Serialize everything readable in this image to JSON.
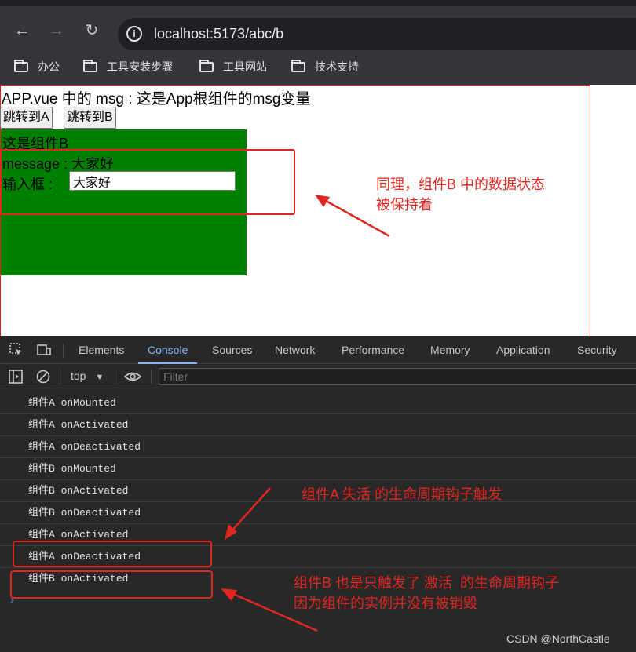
{
  "browser": {
    "back_icon": "arrow-left",
    "forward_icon": "arrow-right",
    "reload_icon": "reload",
    "url": "localhost:5173/abc/b",
    "bookmarks": [
      {
        "label": "办公"
      },
      {
        "label": "工具安装步骤"
      },
      {
        "label": "工具网站"
      },
      {
        "label": "技术支持"
      }
    ]
  },
  "page": {
    "app_line": "APP.vue 中的 msg : 这是App根组件的msg变量",
    "buttons": [
      "跳转到A",
      "跳转到B"
    ],
    "component_b": {
      "title": "这是组件B",
      "message_line": "message : 大家好",
      "input_label": "输入框 :",
      "input_value": "大家好"
    },
    "annotation": "同理，组件B 中的数据状态\n被保持着"
  },
  "devtools": {
    "tabs": [
      "Elements",
      "Console",
      "Sources",
      "Network",
      "Performance",
      "Memory",
      "Application",
      "Security"
    ],
    "active_tab": "Console",
    "context": "top",
    "filter_placeholder": "Filter",
    "logs": [
      "组件A onMounted",
      "组件A onActivated",
      "组件A onDeactivated",
      "组件B onMounted",
      "组件B onActivated",
      "组件B onDeactivated",
      "组件A onActivated",
      "组件A onDeactivated",
      "组件B onActivated"
    ],
    "annotation_1": "组件A 失活 的生命周期钩子触发",
    "annotation_2": "组件B 也是只触发了 激活  的生命周期钩子\n因为组件的实例并没有被销毁"
  },
  "watermark": "CSDN @NorthCastle",
  "colors": {
    "annotation": "#e0261f",
    "component_b_bg": "#008000",
    "active_tab": "#8ab4f8"
  }
}
